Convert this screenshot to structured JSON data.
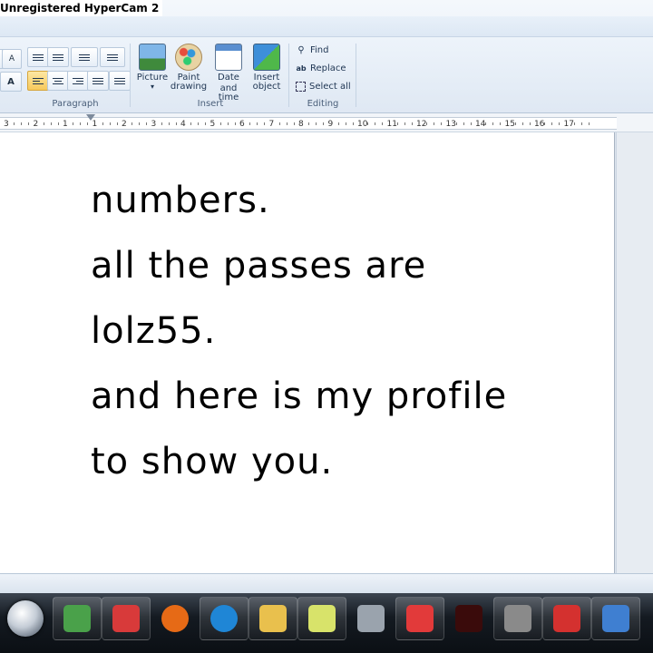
{
  "watermark": "Unregistered HyperCam 2",
  "ribbon": {
    "groups": {
      "paragraph": "Paragraph",
      "insert": "Insert",
      "editing": "Editing"
    },
    "insert_buttons": [
      {
        "label_line1": "Picture",
        "label_line2": "▾",
        "icon": "picture-icon"
      },
      {
        "label_line1": "Paint",
        "label_line2": "drawing",
        "icon": "paint-drawing-icon"
      },
      {
        "label_line1": "Date and",
        "label_line2": "time",
        "icon": "calendar-clock-icon"
      },
      {
        "label_line1": "Insert",
        "label_line2": "object",
        "icon": "insert-object-icon"
      }
    ],
    "editing_items": [
      {
        "label": "Find",
        "icon": "binoculars-icon"
      },
      {
        "label": "Replace",
        "icon": "replace-icon"
      },
      {
        "label": "Select all",
        "icon": "select-all-icon"
      }
    ],
    "font_grow": "A",
    "font_color": "A"
  },
  "ruler": {
    "labels": [
      "3",
      "2",
      "1",
      "1",
      "2",
      "3",
      "4",
      "5",
      "6",
      "7",
      "8",
      "9",
      "10",
      "11",
      "12",
      "13",
      "14",
      "15",
      "16",
      "17"
    ]
  },
  "document": {
    "lines": [
      "numbers.",
      "all the passes are",
      "lolz55.",
      "and here is my profile",
      "to show you."
    ]
  },
  "taskbar": {
    "apps": [
      {
        "name": "windows-live-messenger-icon",
        "color": "#4aa14a"
      },
      {
        "name": "pinned-red-app-icon",
        "color": "#d83a3a"
      },
      {
        "name": "firefox-icon",
        "color": "#e66a16"
      },
      {
        "name": "internet-explorer-icon",
        "color": "#1f86d6"
      },
      {
        "name": "paint-icon",
        "color": "#e9c04d"
      },
      {
        "name": "sticky-notes-icon",
        "color": "#d8e36a"
      },
      {
        "name": "weather-storm-icon",
        "color": "#9aa3ad"
      },
      {
        "name": "roblox-icon",
        "color": "#e23a3a"
      },
      {
        "name": "dark-app-icon",
        "color": "#3a0b0b"
      },
      {
        "name": "hypercam-icon",
        "color": "#8a8a8a"
      },
      {
        "name": "roblox-studio-icon",
        "color": "#d4312f"
      },
      {
        "name": "wordpad-icon",
        "color": "#3f7fd1"
      }
    ]
  }
}
